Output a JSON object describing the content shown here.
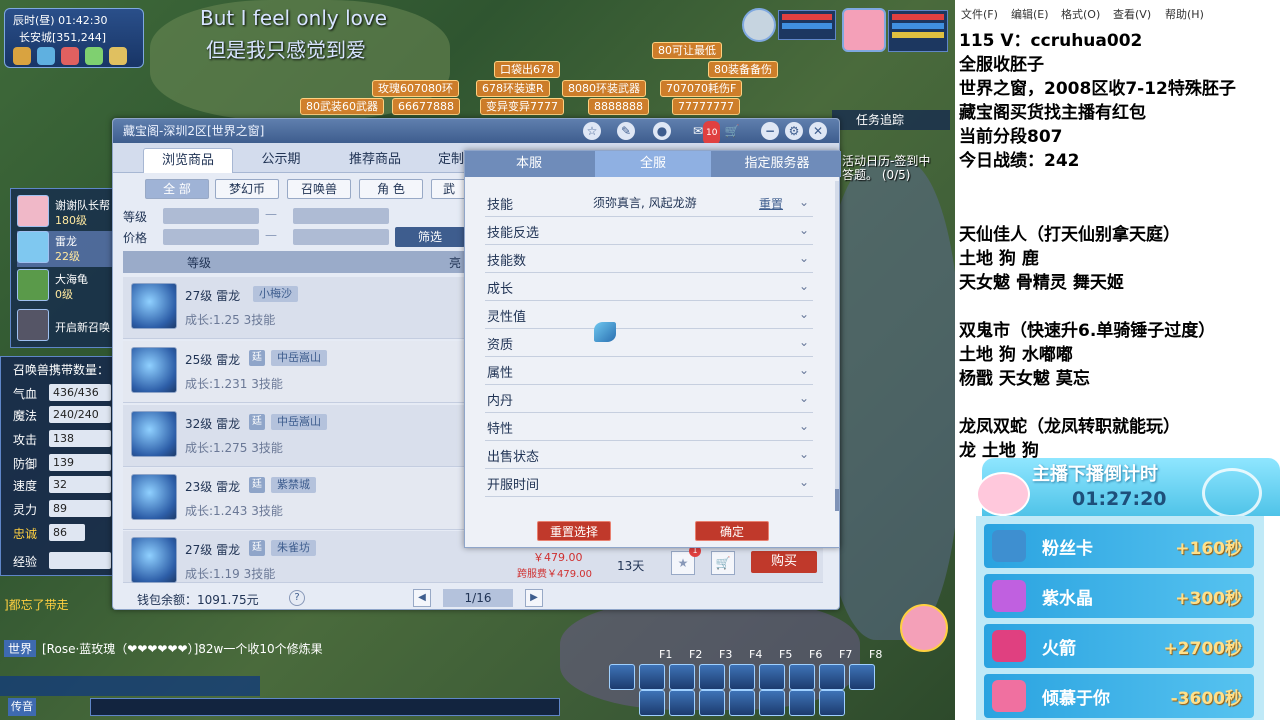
{
  "game": {
    "clock": "辰时(昼)  01:42:30",
    "location": "长安城[351,244]",
    "lyric_en": "But I feel only love",
    "lyric_cn": "但是我只感觉到爱",
    "floating_names": [
      "80可让最低",
      "口袋出678",
      "80装备备伤",
      "玫瑰607080环",
      "678环装速R",
      "8080环装武器",
      "707070耗伤F",
      "80武装60武器",
      "66677888",
      "变异变异7777",
      "8888888",
      "77777777"
    ],
    "task_label": "任务追踪",
    "activity_text": "活动日历-签到中",
    "activity_sub": "答题。 (0/5)",
    "party": [
      {
        "name": "谢谢队长帮",
        "level": "180级"
      },
      {
        "name": "雷龙",
        "level": "22级"
      },
      {
        "name": "大海龟",
        "level": "0级"
      },
      {
        "name": "开启新召唤",
        "level": ""
      }
    ],
    "summon_count_label": "召唤兽携带数量：",
    "stats": [
      {
        "k": "气血",
        "v": "436/436"
      },
      {
        "k": "魔法",
        "v": "240/240"
      },
      {
        "k": "攻击",
        "v": "138"
      },
      {
        "k": "防御",
        "v": "139"
      },
      {
        "k": "速度",
        "v": "32"
      },
      {
        "k": "灵力",
        "v": "89"
      },
      {
        "k": "忠诚",
        "v": "86"
      },
      {
        "k": "经验",
        "v": ""
      }
    ],
    "chat_line1": "]都忘了带走",
    "chat_channel": "世界",
    "chat_line2": "[Rose·蓝玫瑰（❤❤❤❤❤❤）]82w一个收10个修炼果",
    "chat_btn": "传音",
    "fkeys": [
      "F1",
      "F2",
      "F3",
      "F4",
      "F5",
      "F6",
      "F7",
      "F8"
    ]
  },
  "treasure": {
    "title": "藏宝阁-深圳2区[世界之窗]",
    "mail_badge": "10",
    "tabs": [
      "浏览商品",
      "公示期",
      "推荐商品",
      "定制"
    ],
    "categories": [
      "全 部",
      "梦幻币",
      "召唤兽",
      "角 色",
      "武"
    ],
    "level_label": "等级",
    "price_label": "价格",
    "filter_button": "筛选",
    "list_head_level": "等级",
    "list_head_more": "亮",
    "items": [
      {
        "title": "27级 雷龙",
        "sub": "成长:1.25  3技能",
        "tag": "小梅沙",
        "flag": ""
      },
      {
        "title": "25级 雷龙",
        "sub": "成长:1.231  3技能",
        "tag": "中岳嵩山",
        "flag": "廷"
      },
      {
        "title": "32级 雷龙",
        "sub": "成长:1.275  3技能",
        "tag": "中岳嵩山",
        "flag": "廷"
      },
      {
        "title": "23级 雷龙",
        "sub": "成长:1.243  3技能",
        "tag": "紫禁城",
        "flag": "廷"
      },
      {
        "title": "27级 雷龙",
        "sub": "成长:1.19  3技能",
        "tag": "朱雀坊",
        "flag": "廷"
      }
    ],
    "last_price": "￥479.00",
    "last_price2": "跨服费￥479.00",
    "last_days": "13天",
    "buy": "购买",
    "cart_badge": "1",
    "wallet": "钱包余额：1091.75元",
    "help": "?",
    "page": "1/16"
  },
  "filter_popup": {
    "tabs": [
      "本服",
      "全服",
      "指定服务器"
    ],
    "rows": [
      {
        "label": "技能",
        "value": "须弥真言, 风起龙游",
        "reset": "重置"
      },
      {
        "label": "技能反选",
        "value": "",
        "reset": ""
      },
      {
        "label": "技能数",
        "value": "",
        "reset": ""
      },
      {
        "label": "成长",
        "value": "",
        "reset": ""
      },
      {
        "label": "灵性值",
        "value": "",
        "reset": ""
      },
      {
        "label": "资质",
        "value": "",
        "reset": ""
      },
      {
        "label": "属性",
        "value": "",
        "reset": ""
      },
      {
        "label": "内丹",
        "value": "",
        "reset": ""
      },
      {
        "label": "特性",
        "value": "",
        "reset": ""
      },
      {
        "label": "出售状态",
        "value": "",
        "reset": ""
      },
      {
        "label": "开服时间",
        "value": "",
        "reset": ""
      }
    ],
    "reset_button": "重置选择",
    "confirm_button": "确定"
  },
  "overlay": {
    "menu": [
      "文件(F)",
      "编辑(E)",
      "格式(O)",
      "查看(V)",
      "帮助(H)"
    ],
    "lines": [
      "115  V：ccruhua002",
      "全服收胚子",
      "世界之窗，2008区收7-12特殊胚子",
      "藏宝阁买货找主播有红包",
      "当前分段807",
      "今日战绩：242",
      "",
      "天仙佳人（打天仙别拿天庭）",
      "土地 狗 鹿",
      "天女魃 骨精灵 舞天姬",
      "",
      "双鬼市（快速升6.单骑锤子过度）",
      "土地 狗 水嘟嘟",
      "杨戬 天女魃 莫忘",
      "",
      "龙凤双蛇（龙凤转职就能玩）",
      "龙    土地       狗"
    ],
    "countdown_title": "主播下播倒计时",
    "countdown_time": "01:27:20",
    "gifts": [
      {
        "name": "粉丝卡",
        "value": "+160秒"
      },
      {
        "name": "紫水晶",
        "value": "+300秒"
      },
      {
        "name": "火箭",
        "value": "+2700秒"
      },
      {
        "name": "倾慕于你",
        "value": "-3600秒"
      }
    ]
  },
  "colors": {
    "accent": "#3e5d8e",
    "danger": "#c0392b",
    "overlay_bg": "#ffffff"
  }
}
